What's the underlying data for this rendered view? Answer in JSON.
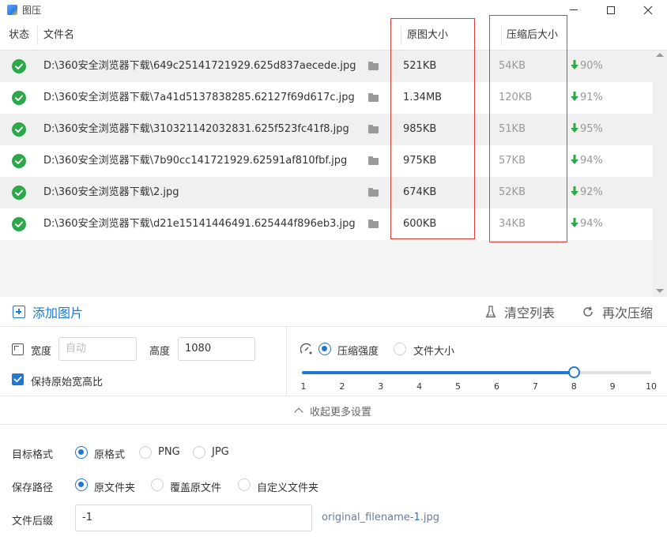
{
  "window": {
    "title": "图压"
  },
  "table": {
    "headers": {
      "status": "状态",
      "filename": "文件名",
      "original_size": "原图大小",
      "compressed_size": "压缩后大小"
    },
    "rows": [
      {
        "file": "D:\\360安全浏览器下载\\649c25141721929.625d837aecede.jpg",
        "orig": "521KB",
        "comp": "54KB",
        "pct": "90%"
      },
      {
        "file": "D:\\360安全浏览器下载\\7a41d5137838285.62127f69d617c.jpg",
        "orig": "1.34MB",
        "comp": "120KB",
        "pct": "91%"
      },
      {
        "file": "D:\\360安全浏览器下载\\310321142032831.625f523fc41f8.jpg",
        "orig": "985KB",
        "comp": "51KB",
        "pct": "95%"
      },
      {
        "file": "D:\\360安全浏览器下载\\7b90cc141721929.62591af810fbf.jpg",
        "orig": "975KB",
        "comp": "57KB",
        "pct": "94%"
      },
      {
        "file": "D:\\360安全浏览器下载\\2.jpg",
        "orig": "674KB",
        "comp": "52KB",
        "pct": "92%"
      },
      {
        "file": "D:\\360安全浏览器下载\\d21e15141446491.625444f896eb3.jpg",
        "orig": "600KB",
        "comp": "34KB",
        "pct": "94%"
      }
    ]
  },
  "actions": {
    "add": "添加图片",
    "clear": "清空列表",
    "recompress": "再次压缩"
  },
  "resize": {
    "width_label": "宽度",
    "width_placeholder": "自动",
    "height_label": "高度",
    "height_value": "1080",
    "keep_ratio_label": "保持原始宽高比"
  },
  "compression": {
    "mode_strength": "压缩强度",
    "mode_filesize": "文件大小",
    "ticks": [
      "1",
      "2",
      "3",
      "4",
      "5",
      "6",
      "7",
      "8",
      "9",
      "10"
    ],
    "slider_value": 8,
    "slider_min": 1,
    "slider_max": 10
  },
  "collapse_label": "收起更多设置",
  "format": {
    "label": "目标格式",
    "options": [
      "原格式",
      "PNG",
      "JPG"
    ],
    "selected": "原格式"
  },
  "save_path": {
    "label": "保存路径",
    "options": [
      "原文件夹",
      "覆盖原文件",
      "自定义文件夹"
    ],
    "selected": "原文件夹"
  },
  "suffix": {
    "label": "文件后缀",
    "value": "-1",
    "preview_prefix": "original_filename",
    "preview_suffix": "-1",
    "preview_ext": ".jpg"
  },
  "colors": {
    "accent": "#1f78d1",
    "success": "#2aa84a",
    "highlight": "#e53a3a"
  }
}
